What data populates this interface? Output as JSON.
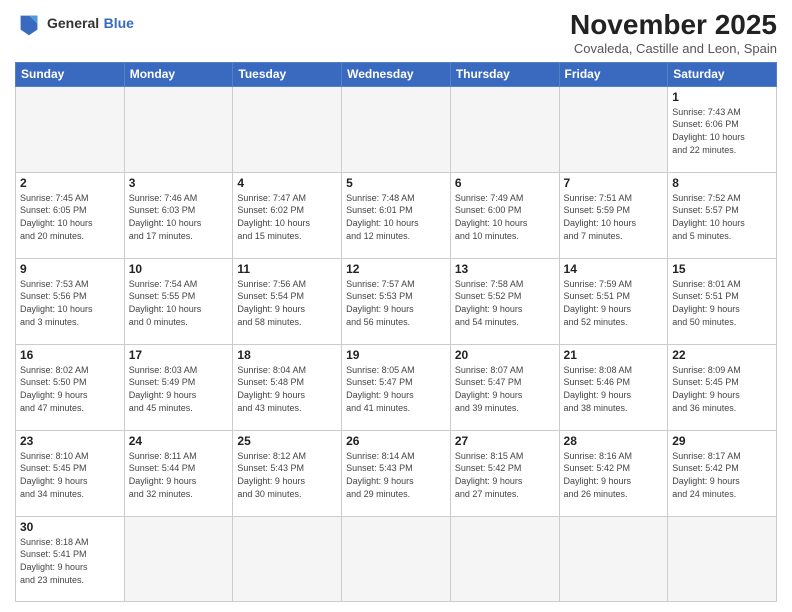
{
  "header": {
    "logo_line1": "General",
    "logo_line2": "Blue",
    "month_year": "November 2025",
    "location": "Covaleda, Castille and Leon, Spain"
  },
  "days_of_week": [
    "Sunday",
    "Monday",
    "Tuesday",
    "Wednesday",
    "Thursday",
    "Friday",
    "Saturday"
  ],
  "weeks": [
    [
      {
        "day": "",
        "info": ""
      },
      {
        "day": "",
        "info": ""
      },
      {
        "day": "",
        "info": ""
      },
      {
        "day": "",
        "info": ""
      },
      {
        "day": "",
        "info": ""
      },
      {
        "day": "",
        "info": ""
      },
      {
        "day": "1",
        "info": "Sunrise: 7:43 AM\nSunset: 6:06 PM\nDaylight: 10 hours\nand 22 minutes."
      }
    ],
    [
      {
        "day": "2",
        "info": "Sunrise: 7:45 AM\nSunset: 6:05 PM\nDaylight: 10 hours\nand 20 minutes."
      },
      {
        "day": "3",
        "info": "Sunrise: 7:46 AM\nSunset: 6:03 PM\nDaylight: 10 hours\nand 17 minutes."
      },
      {
        "day": "4",
        "info": "Sunrise: 7:47 AM\nSunset: 6:02 PM\nDaylight: 10 hours\nand 15 minutes."
      },
      {
        "day": "5",
        "info": "Sunrise: 7:48 AM\nSunset: 6:01 PM\nDaylight: 10 hours\nand 12 minutes."
      },
      {
        "day": "6",
        "info": "Sunrise: 7:49 AM\nSunset: 6:00 PM\nDaylight: 10 hours\nand 10 minutes."
      },
      {
        "day": "7",
        "info": "Sunrise: 7:51 AM\nSunset: 5:59 PM\nDaylight: 10 hours\nand 7 minutes."
      },
      {
        "day": "8",
        "info": "Sunrise: 7:52 AM\nSunset: 5:57 PM\nDaylight: 10 hours\nand 5 minutes."
      }
    ],
    [
      {
        "day": "9",
        "info": "Sunrise: 7:53 AM\nSunset: 5:56 PM\nDaylight: 10 hours\nand 3 minutes."
      },
      {
        "day": "10",
        "info": "Sunrise: 7:54 AM\nSunset: 5:55 PM\nDaylight: 10 hours\nand 0 minutes."
      },
      {
        "day": "11",
        "info": "Sunrise: 7:56 AM\nSunset: 5:54 PM\nDaylight: 9 hours\nand 58 minutes."
      },
      {
        "day": "12",
        "info": "Sunrise: 7:57 AM\nSunset: 5:53 PM\nDaylight: 9 hours\nand 56 minutes."
      },
      {
        "day": "13",
        "info": "Sunrise: 7:58 AM\nSunset: 5:52 PM\nDaylight: 9 hours\nand 54 minutes."
      },
      {
        "day": "14",
        "info": "Sunrise: 7:59 AM\nSunset: 5:51 PM\nDaylight: 9 hours\nand 52 minutes."
      },
      {
        "day": "15",
        "info": "Sunrise: 8:01 AM\nSunset: 5:51 PM\nDaylight: 9 hours\nand 50 minutes."
      }
    ],
    [
      {
        "day": "16",
        "info": "Sunrise: 8:02 AM\nSunset: 5:50 PM\nDaylight: 9 hours\nand 47 minutes."
      },
      {
        "day": "17",
        "info": "Sunrise: 8:03 AM\nSunset: 5:49 PM\nDaylight: 9 hours\nand 45 minutes."
      },
      {
        "day": "18",
        "info": "Sunrise: 8:04 AM\nSunset: 5:48 PM\nDaylight: 9 hours\nand 43 minutes."
      },
      {
        "day": "19",
        "info": "Sunrise: 8:05 AM\nSunset: 5:47 PM\nDaylight: 9 hours\nand 41 minutes."
      },
      {
        "day": "20",
        "info": "Sunrise: 8:07 AM\nSunset: 5:47 PM\nDaylight: 9 hours\nand 39 minutes."
      },
      {
        "day": "21",
        "info": "Sunrise: 8:08 AM\nSunset: 5:46 PM\nDaylight: 9 hours\nand 38 minutes."
      },
      {
        "day": "22",
        "info": "Sunrise: 8:09 AM\nSunset: 5:45 PM\nDaylight: 9 hours\nand 36 minutes."
      }
    ],
    [
      {
        "day": "23",
        "info": "Sunrise: 8:10 AM\nSunset: 5:45 PM\nDaylight: 9 hours\nand 34 minutes."
      },
      {
        "day": "24",
        "info": "Sunrise: 8:11 AM\nSunset: 5:44 PM\nDaylight: 9 hours\nand 32 minutes."
      },
      {
        "day": "25",
        "info": "Sunrise: 8:12 AM\nSunset: 5:43 PM\nDaylight: 9 hours\nand 30 minutes."
      },
      {
        "day": "26",
        "info": "Sunrise: 8:14 AM\nSunset: 5:43 PM\nDaylight: 9 hours\nand 29 minutes."
      },
      {
        "day": "27",
        "info": "Sunrise: 8:15 AM\nSunset: 5:42 PM\nDaylight: 9 hours\nand 27 minutes."
      },
      {
        "day": "28",
        "info": "Sunrise: 8:16 AM\nSunset: 5:42 PM\nDaylight: 9 hours\nand 26 minutes."
      },
      {
        "day": "29",
        "info": "Sunrise: 8:17 AM\nSunset: 5:42 PM\nDaylight: 9 hours\nand 24 minutes."
      }
    ],
    [
      {
        "day": "30",
        "info": "Sunrise: 8:18 AM\nSunset: 5:41 PM\nDaylight: 9 hours\nand 23 minutes."
      },
      {
        "day": "",
        "info": ""
      },
      {
        "day": "",
        "info": ""
      },
      {
        "day": "",
        "info": ""
      },
      {
        "day": "",
        "info": ""
      },
      {
        "day": "",
        "info": ""
      },
      {
        "day": "",
        "info": ""
      }
    ]
  ]
}
